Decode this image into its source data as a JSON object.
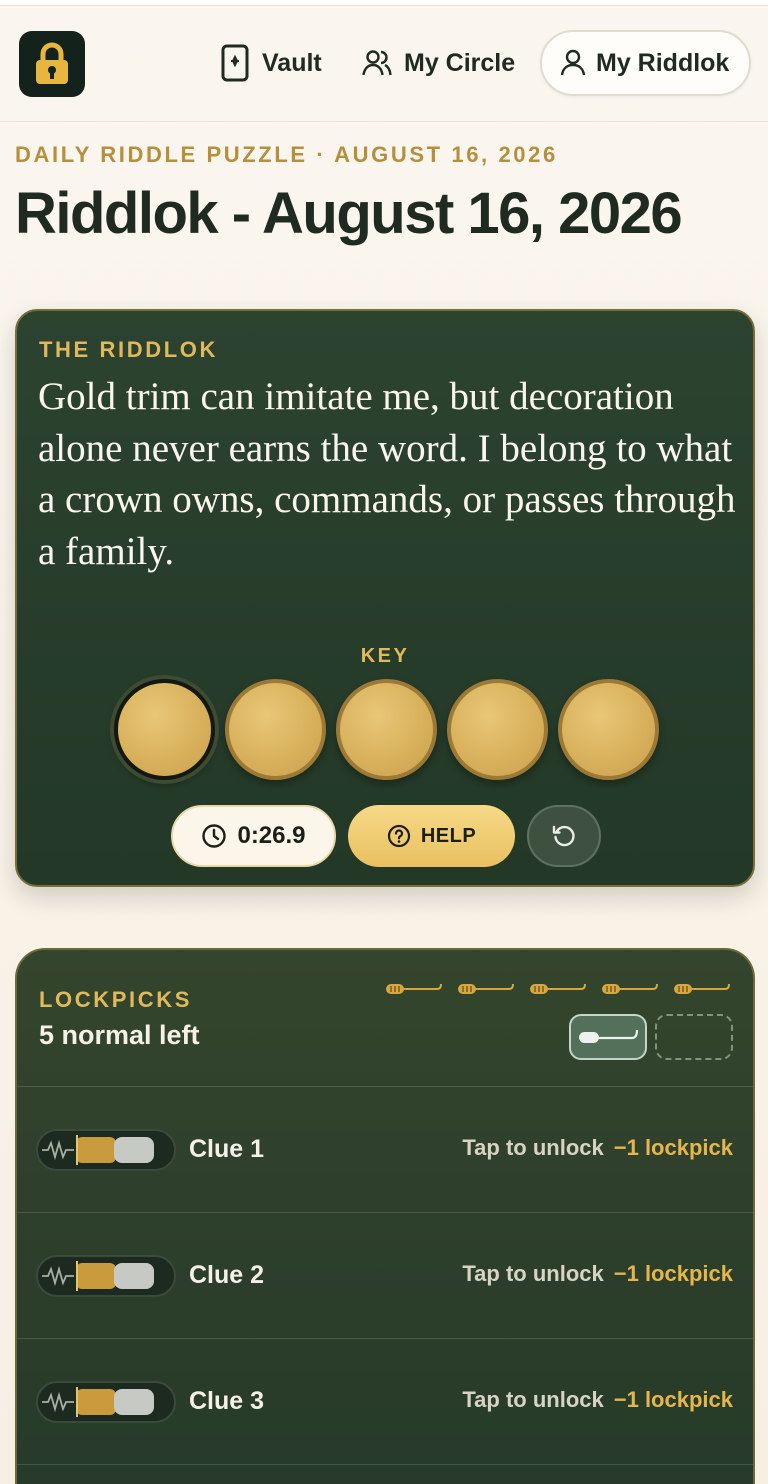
{
  "nav": {
    "vault": "Vault",
    "circle": "My Circle",
    "mine": "My Riddlok"
  },
  "page": {
    "kicker": "DAILY RIDDLE PUZZLE · AUGUST 16, 2026",
    "title": "Riddlok - August 16, 2026"
  },
  "riddle": {
    "label": "THE RIDDLOK",
    "text": "Gold trim can imitate me, but decoration alone never earns the word. I belong to what a crown owns, commands, or passes through a family.",
    "key_label": "KEY",
    "slots": 5,
    "timer": "0:26.9",
    "help": "HELP"
  },
  "lockpicks": {
    "label": "LOCKPICKS",
    "remaining": "5 normal left",
    "count": 5,
    "clues": [
      {
        "name": "Clue 1",
        "action": "Tap to unlock",
        "cost": "−1 lockpick"
      },
      {
        "name": "Clue 2",
        "action": "Tap to unlock",
        "cost": "−1 lockpick"
      },
      {
        "name": "Clue 3",
        "action": "Tap to unlock",
        "cost": "−1 lockpick"
      }
    ]
  },
  "colors": {
    "accent": "#e1b95a",
    "card": "#2c4330",
    "coin": "#d9b15c"
  }
}
